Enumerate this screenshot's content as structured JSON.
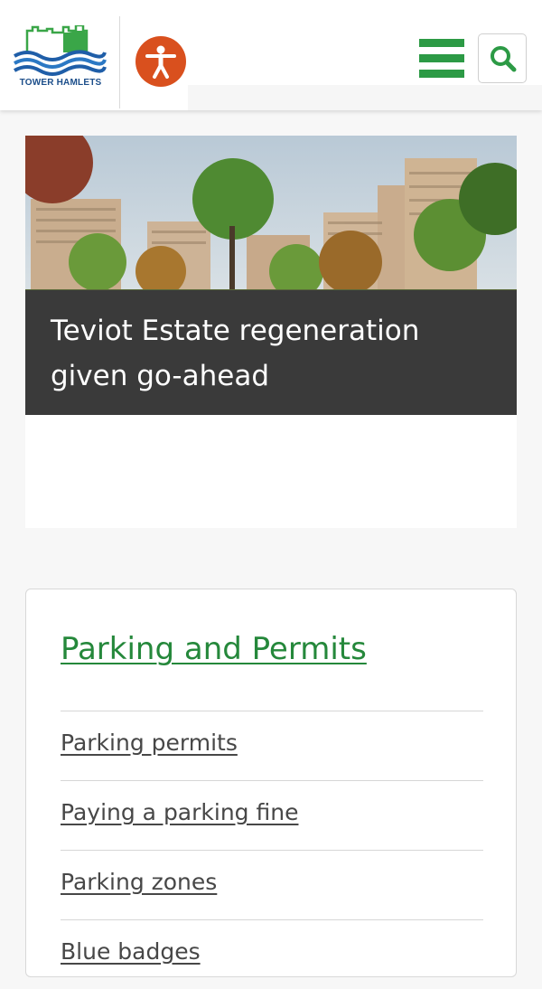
{
  "header": {
    "logo_text": "TOWER HAMLETS",
    "accessibility_label": "Accessibility",
    "menu_label": "Menu",
    "search_label": "Search"
  },
  "carousel": {
    "slides": [
      {
        "caption_line1": "Teviot Estate regeneration",
        "caption_line2": "given go-ahead"
      }
    ],
    "dot_count": 3,
    "active_dot": 1
  },
  "card": {
    "title": "Parking and Permits",
    "links": [
      {
        "label": "Parking permits"
      },
      {
        "label": "Paying a parking fine"
      },
      {
        "label": "Parking zones"
      },
      {
        "label": "Blue badges"
      }
    ]
  },
  "colors": {
    "brand_green": "#2c9a45",
    "title_green": "#25883b",
    "accent_orange": "#d9501e",
    "dot_active": "#0b57a2",
    "dot_inactive": "#d6d6d6",
    "logo_blue": "#1c4e8a"
  },
  "icons": {
    "menu": "hamburger-icon",
    "search": "search-icon",
    "accessibility": "accessibility-person-icon"
  }
}
